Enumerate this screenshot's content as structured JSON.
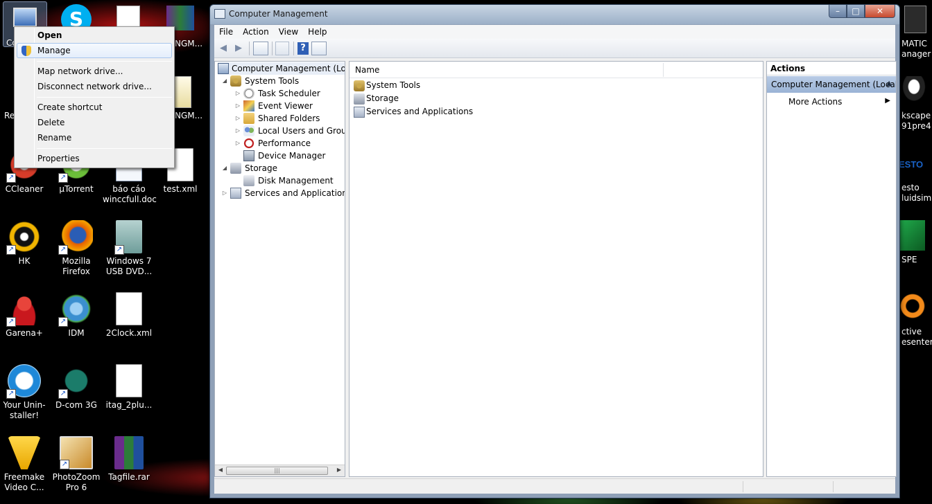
{
  "desktop": {
    "icons": [
      {
        "label": "CCleaner",
        "icon": "ccleaner-icon",
        "color": "#d63c2a"
      },
      {
        "label": "µTorrent",
        "icon": "utorrent-icon",
        "color": "#6cbf3a"
      },
      {
        "label": "báo cáo winccfull.doc",
        "icon": "word-document-icon",
        "color": "#ffffff"
      },
      {
        "label": "test.xml",
        "icon": "xml-file-icon",
        "color": "#ffffff"
      },
      {
        "label": "HK",
        "icon": "hk-icon",
        "color": "#f0b400"
      },
      {
        "label": "Mozilla Firefox",
        "icon": "firefox-icon",
        "color": "#e66000"
      },
      {
        "label": "Windows 7 USB DVD...",
        "icon": "windows-usb-tool-icon",
        "color": "#7aa7a4"
      },
      {
        "label": "Garena+",
        "icon": "garena-icon",
        "color": "#c9181e"
      },
      {
        "label": "IDM",
        "icon": "idm-icon",
        "color": "#3b8fd0"
      },
      {
        "label": "2Clock.xml",
        "icon": "xml-file-icon",
        "color": "#ffffff"
      },
      {
        "label": "Your Unin-staller!",
        "icon": "uninstaller-icon",
        "color": "#1e88d8"
      },
      {
        "label": "D-com 3G",
        "icon": "dcom-3g-icon",
        "color": "#1b7c6a"
      },
      {
        "label": "itag_2plu...",
        "icon": "xml-file-icon",
        "color": "#ffffff"
      },
      {
        "label": "Freemake Video C...",
        "icon": "freemake-icon",
        "color": "#f2c200"
      },
      {
        "label": "PhotoZoom Pro 6",
        "icon": "photozoom-icon",
        "color": "#c98a2a"
      },
      {
        "label": "Tagfile.rar",
        "icon": "winrar-archive-icon",
        "color": "#6a2c8c"
      }
    ],
    "top_partial_labels": {
      "c1": "Co",
      "re": "Re",
      "ngm1": "NGM...",
      "ngm2": "NGM..."
    },
    "right_edge_labels": [
      "MATIC",
      "anager",
      "kscape",
      "91pre4",
      "esto",
      "luidsim",
      "SPE",
      "ctive",
      "esenter"
    ]
  },
  "context_menu": {
    "items": [
      {
        "label": "Open",
        "bold": true
      },
      {
        "label": "Manage",
        "highlighted": true,
        "icon": "uac-shield-icon"
      },
      {
        "label": "Map network drive..."
      },
      {
        "label": "Disconnect network drive..."
      },
      {
        "label": "Create shortcut"
      },
      {
        "label": "Delete"
      },
      {
        "label": "Rename"
      },
      {
        "label": "Properties"
      }
    ]
  },
  "window": {
    "title": "Computer Management",
    "caption": {
      "minimize": "–",
      "maximize": "□",
      "close": "✕"
    },
    "menu": [
      "File",
      "Action",
      "View",
      "Help"
    ],
    "toolbar": {
      "back": "◀",
      "forward": "▶",
      "help": "?"
    },
    "tree": {
      "root": "Computer Management (Local)",
      "items": [
        {
          "label": "System Tools",
          "level": 1,
          "expander": "◢",
          "icon": "tools-icon"
        },
        {
          "label": "Task Scheduler",
          "level": 2,
          "expander": "▷",
          "icon": "clock-icon"
        },
        {
          "label": "Event Viewer",
          "level": 2,
          "expander": "▷",
          "icon": "event-viewer-icon"
        },
        {
          "label": "Shared Folders",
          "level": 2,
          "expander": "▷",
          "icon": "shared-folder-icon"
        },
        {
          "label": "Local Users and Groups",
          "level": 2,
          "expander": "▷",
          "icon": "users-icon"
        },
        {
          "label": "Performance",
          "level": 2,
          "expander": "▷",
          "icon": "performance-icon"
        },
        {
          "label": "Device Manager",
          "level": 2,
          "expander": "",
          "icon": "device-manager-icon"
        },
        {
          "label": "Storage",
          "level": 1,
          "expander": "◢",
          "icon": "storage-icon"
        },
        {
          "label": "Disk Management",
          "level": 2,
          "expander": "",
          "icon": "disk-icon"
        },
        {
          "label": "Services and Applications",
          "level": 1,
          "expander": "▷",
          "icon": "services-icon"
        }
      ],
      "scroll": {
        "left": "◀",
        "grip": "|||",
        "right": "▶"
      }
    },
    "list": {
      "column_name": "Name",
      "rows": [
        {
          "label": "System Tools",
          "icon": "tools-icon"
        },
        {
          "label": "Storage",
          "icon": "storage-icon"
        },
        {
          "label": "Services and Applications",
          "icon": "services-icon"
        }
      ]
    },
    "actions": {
      "header": "Actions",
      "section": "Computer Management (Local)",
      "section_caret": "▲",
      "more_actions": "More Actions",
      "more_arrow": "▶"
    }
  }
}
